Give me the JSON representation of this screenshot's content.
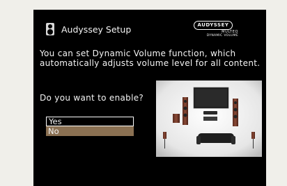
{
  "screen": {
    "title": "Audyssey Setup",
    "logo": {
      "brand": "AUDYSSEY",
      "line1": "MULTEQ",
      "line2": "DYNAMIC VOLUME"
    },
    "description": "You can set Dynamic Volume function, which automatically adjusts volume level for all content.",
    "prompt": "Do you want to enable?",
    "options": [
      {
        "label": "Yes",
        "state": "focused"
      },
      {
        "label": "No",
        "state": "highlighted"
      }
    ],
    "colors": {
      "background": "#000000",
      "text": "#f4f4f4",
      "selection": "#8a7052",
      "focus_border": "#ffffff"
    },
    "icons": [
      "speaker-icon"
    ]
  }
}
